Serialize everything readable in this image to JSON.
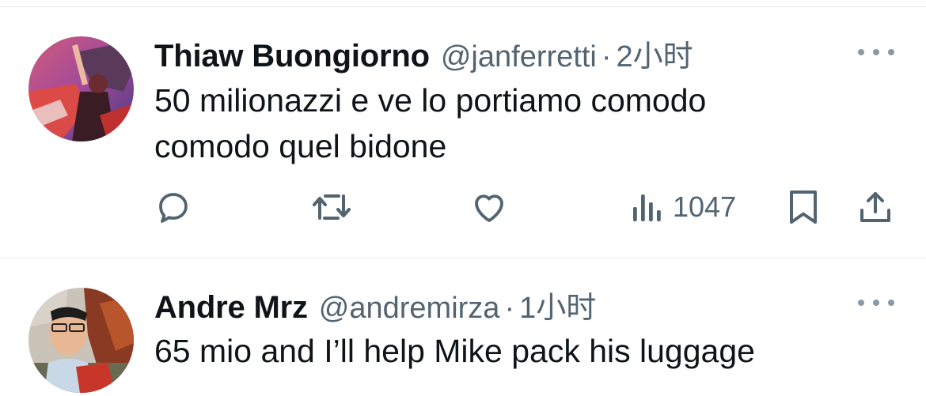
{
  "tweets": [
    {
      "display_name": "Thiaw Buongiorno",
      "handle": "@janferretti",
      "separator": "·",
      "time": "2小时",
      "text_lines": [
        "50 milionazzi e ve lo portiamo comodo",
        "comodo quel bidone"
      ],
      "views": "1047",
      "icons": {
        "more": "more-dots-icon",
        "reply": "reply-icon",
        "retweet": "retweet-icon",
        "like": "like-heart-icon",
        "views": "views-bars-icon",
        "bookmark": "bookmark-icon",
        "share": "share-icon"
      }
    },
    {
      "display_name": "Andre Mrz",
      "handle": "@andremirza",
      "separator": "·",
      "time": "1小时",
      "text_lines": [
        "65 mio and I’ll help Mike pack his luggage"
      ],
      "icons": {
        "more": "more-dots-icon"
      }
    }
  ],
  "colors": {
    "text_primary": "#0f1419",
    "text_secondary": "#536471",
    "divider": "#e3e6e9",
    "icon": "#536471"
  }
}
